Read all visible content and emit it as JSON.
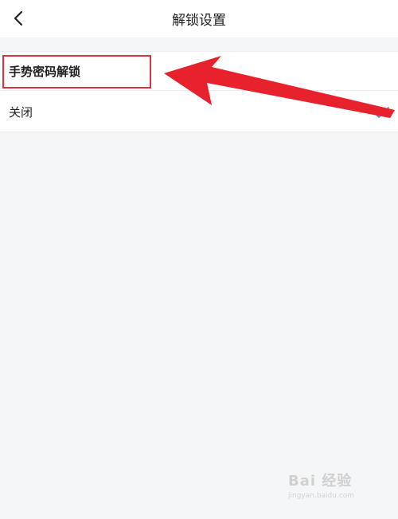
{
  "header": {
    "title": "解锁设置",
    "back_icon": "chevron-left-icon"
  },
  "settings": {
    "section_title": "手势密码解锁",
    "options": [
      {
        "label": "关闭",
        "selected": true,
        "check_icon": "checkmark-icon"
      }
    ]
  },
  "annotation": {
    "highlight_color": "#d6323f",
    "arrow_color": "#e8222d",
    "arrow_icon": "pointer-arrow-icon"
  },
  "watermark": {
    "logo_text": "Bai 经验",
    "url": "jingyan.baidu.com"
  },
  "colors": {
    "background": "#f5f6f8",
    "surface": "#ffffff",
    "text": "#222222",
    "accent": "#4a90e2"
  }
}
